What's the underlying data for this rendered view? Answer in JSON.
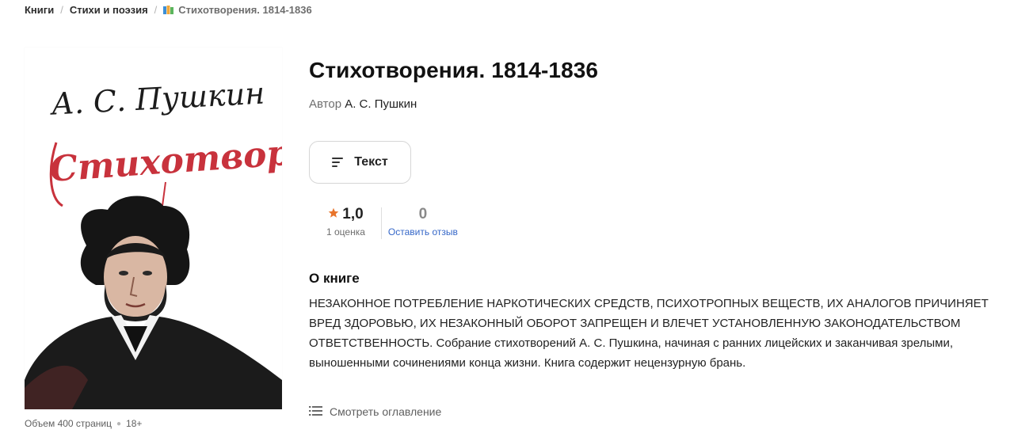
{
  "breadcrumb": {
    "items": [
      "Книги",
      "Стихи и поэзия"
    ],
    "separator": "/",
    "current": "Стихотворения. 1814-1836",
    "current_icon": "book-icon"
  },
  "book": {
    "title": "Стихотворения. 1814-1836",
    "author_prefix": "Автор",
    "author": "А. С. Пушкин",
    "cover": {
      "script_author": "А. С. Пушкин",
      "script_title": "Стихотворения",
      "title_color": "#c8323c",
      "portrait": "portrait-image"
    },
    "meta": {
      "pages": "Объем 400 страниц",
      "age": "18+"
    }
  },
  "format_button": {
    "label": "Текст",
    "icon": "text-lines-icon"
  },
  "rating": {
    "value": "1,0",
    "count_label": "1 оценка",
    "star_color": "#e8742b",
    "reviews_value": "0",
    "reviews_link": "Оставить отзыв"
  },
  "about": {
    "heading": "О книге",
    "text": "НЕЗАКОННОЕ ПОТРЕБЛЕНИЕ НАРКОТИЧЕСКИХ СРЕДСТВ, ПСИХОТРОПНЫХ ВЕЩЕСТВ, ИХ АНАЛОГОВ ПРИЧИНЯЕТ ВРЕД ЗДОРОВЬЮ, ИХ НЕЗАКОННЫЙ ОБОРОТ ЗАПРЕЩЕН И ВЛЕЧЕТ УСТАНОВЛЕННУЮ ЗАКОНОДАТЕЛЬСТВОМ ОТВЕТСТВЕННОСТЬ. Собрание стихотворений А. С. Пушкина, начиная с ранних лицейских и заканчивая зрелыми, выношенными сочинениями конца жизни. Книга содержит нецензурную брань.",
    "toc_link": "Смотреть оглавление",
    "toc_icon": "list-icon"
  }
}
